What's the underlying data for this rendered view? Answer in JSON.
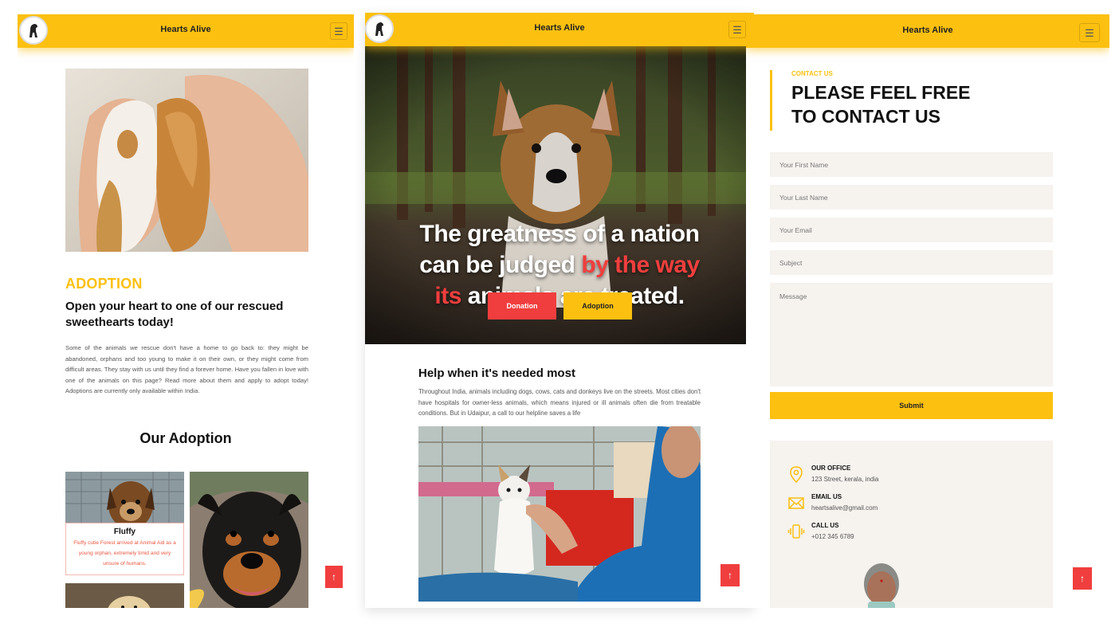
{
  "brand": {
    "name": "Hearts Alive",
    "accent": "#fcc010",
    "red": "#f03e3e"
  },
  "panels": {
    "adoption": {
      "nav_title": "Hearts Alive",
      "kicker": "ADOPTION",
      "heading": "Open your heart to one of our rescued sweethearts today!",
      "body": "Some of the animals we rescue don't have a home to go back to: they might be abandoned, orphans and too young to make it on their own, or they might come from difficult areas. They stay with us until they find a forever home. Have you fallen in love with one of the animals on this page? Read more about them and apply to adopt today! Adoptions are currently only available within India.",
      "section_title": "Our Adoption",
      "card": {
        "name": "Fluffy",
        "description": "Fluffy cutie Forest arrived at Animal Aid as a young orphan, extremely timid and very unsure of humans."
      },
      "to_top_icon": "arrow-up"
    },
    "home": {
      "nav_title": "Hearts Alive",
      "hero": {
        "line1": "The greatness of a nation",
        "line2a": "can be judged ",
        "line2b": "by the way",
        "line3a": "its",
        "line3b": " animals are treated."
      },
      "donation_label": "Donation",
      "adoption_label": "Adoption",
      "help_heading": "Help when it's needed most",
      "help_body": "Throughout India, animals including dogs, cows, cats and donkeys live on the streets. Most cities don't have hospitals for owner-less animals, which means injured or ill animals often die from treatable conditions. But in Udaipur, a call to our helpline saves a life",
      "to_top_icon": "arrow-up"
    },
    "contact": {
      "nav_title": "Hearts Alive",
      "kicker": "CONTACT US",
      "title": "PLEASE FEEL FREE TO CONTACT US",
      "fields": {
        "first_name": "Your First Name",
        "last_name": "Your Last Name",
        "email": "Your Email",
        "subject": "Subject",
        "message": "Message"
      },
      "submit_label": "Submit",
      "office_label": "OUR OFFICE",
      "office_value": "123 Street, kerala, india",
      "email_label": "EMAIL US",
      "email_value": "heartsalive@gmail.com",
      "call_label": "CALL US",
      "call_value": "+012 345 6789",
      "to_top_icon": "arrow-up"
    }
  }
}
